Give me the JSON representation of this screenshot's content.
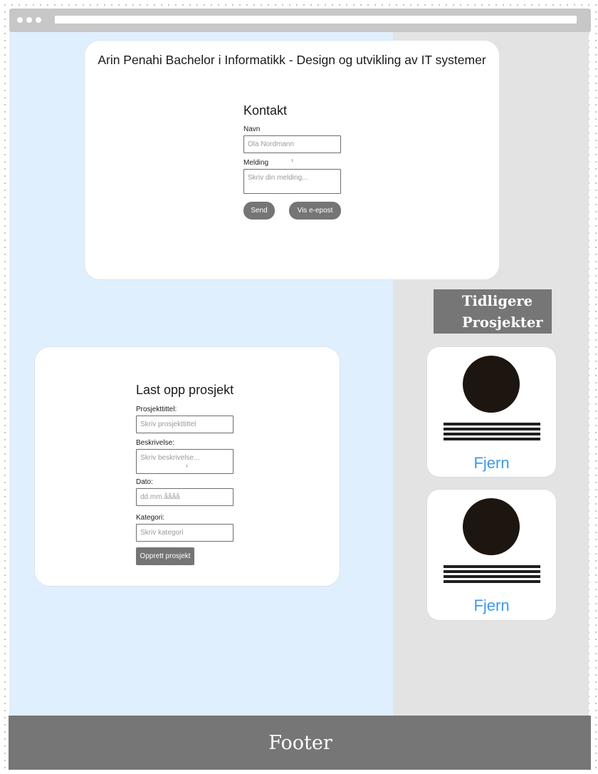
{
  "header": {
    "title": "Arin Penahi Bachelor i Informatikk - Design og utvikling av IT systemer"
  },
  "contact_form": {
    "heading": "Kontakt",
    "name_label": "Navn",
    "name_placeholder": "Ola Nordmann",
    "message_label": "Melding",
    "message_placeholder": "Skriv din melding...",
    "send_label": "Send",
    "email_label": "Vis e-epost"
  },
  "upload_form": {
    "heading": "Last opp prosjekt",
    "title_label": "Prosjekttittel:",
    "title_placeholder": "Skriv prosjekttittel",
    "description_label": "Beskrivelse:",
    "description_placeholder": "Skriv beskrivelse...",
    "date_label": "Dato:",
    "date_placeholder": "dd.mm.åååå",
    "category_label": "Kategori:",
    "category_placeholder": "Skriv kategori",
    "submit_label": "Opprett prosjekt"
  },
  "projects": {
    "heading": "Tidligere Prosjekter",
    "items": [
      {
        "remove_label": "Fjern"
      },
      {
        "remove_label": "Fjern"
      }
    ]
  },
  "footer": {
    "label": "Footer"
  },
  "colors": {
    "left_panel_bg": "#dfeffd",
    "right_panel_bg": "#e3e3e3",
    "button_gray": "#757575",
    "link_blue": "#3d9ae8",
    "avatar_dark": "#1d1510"
  },
  "icons": [
    "window-control-dots",
    "avatar-placeholder",
    "text-lines-placeholder"
  ]
}
